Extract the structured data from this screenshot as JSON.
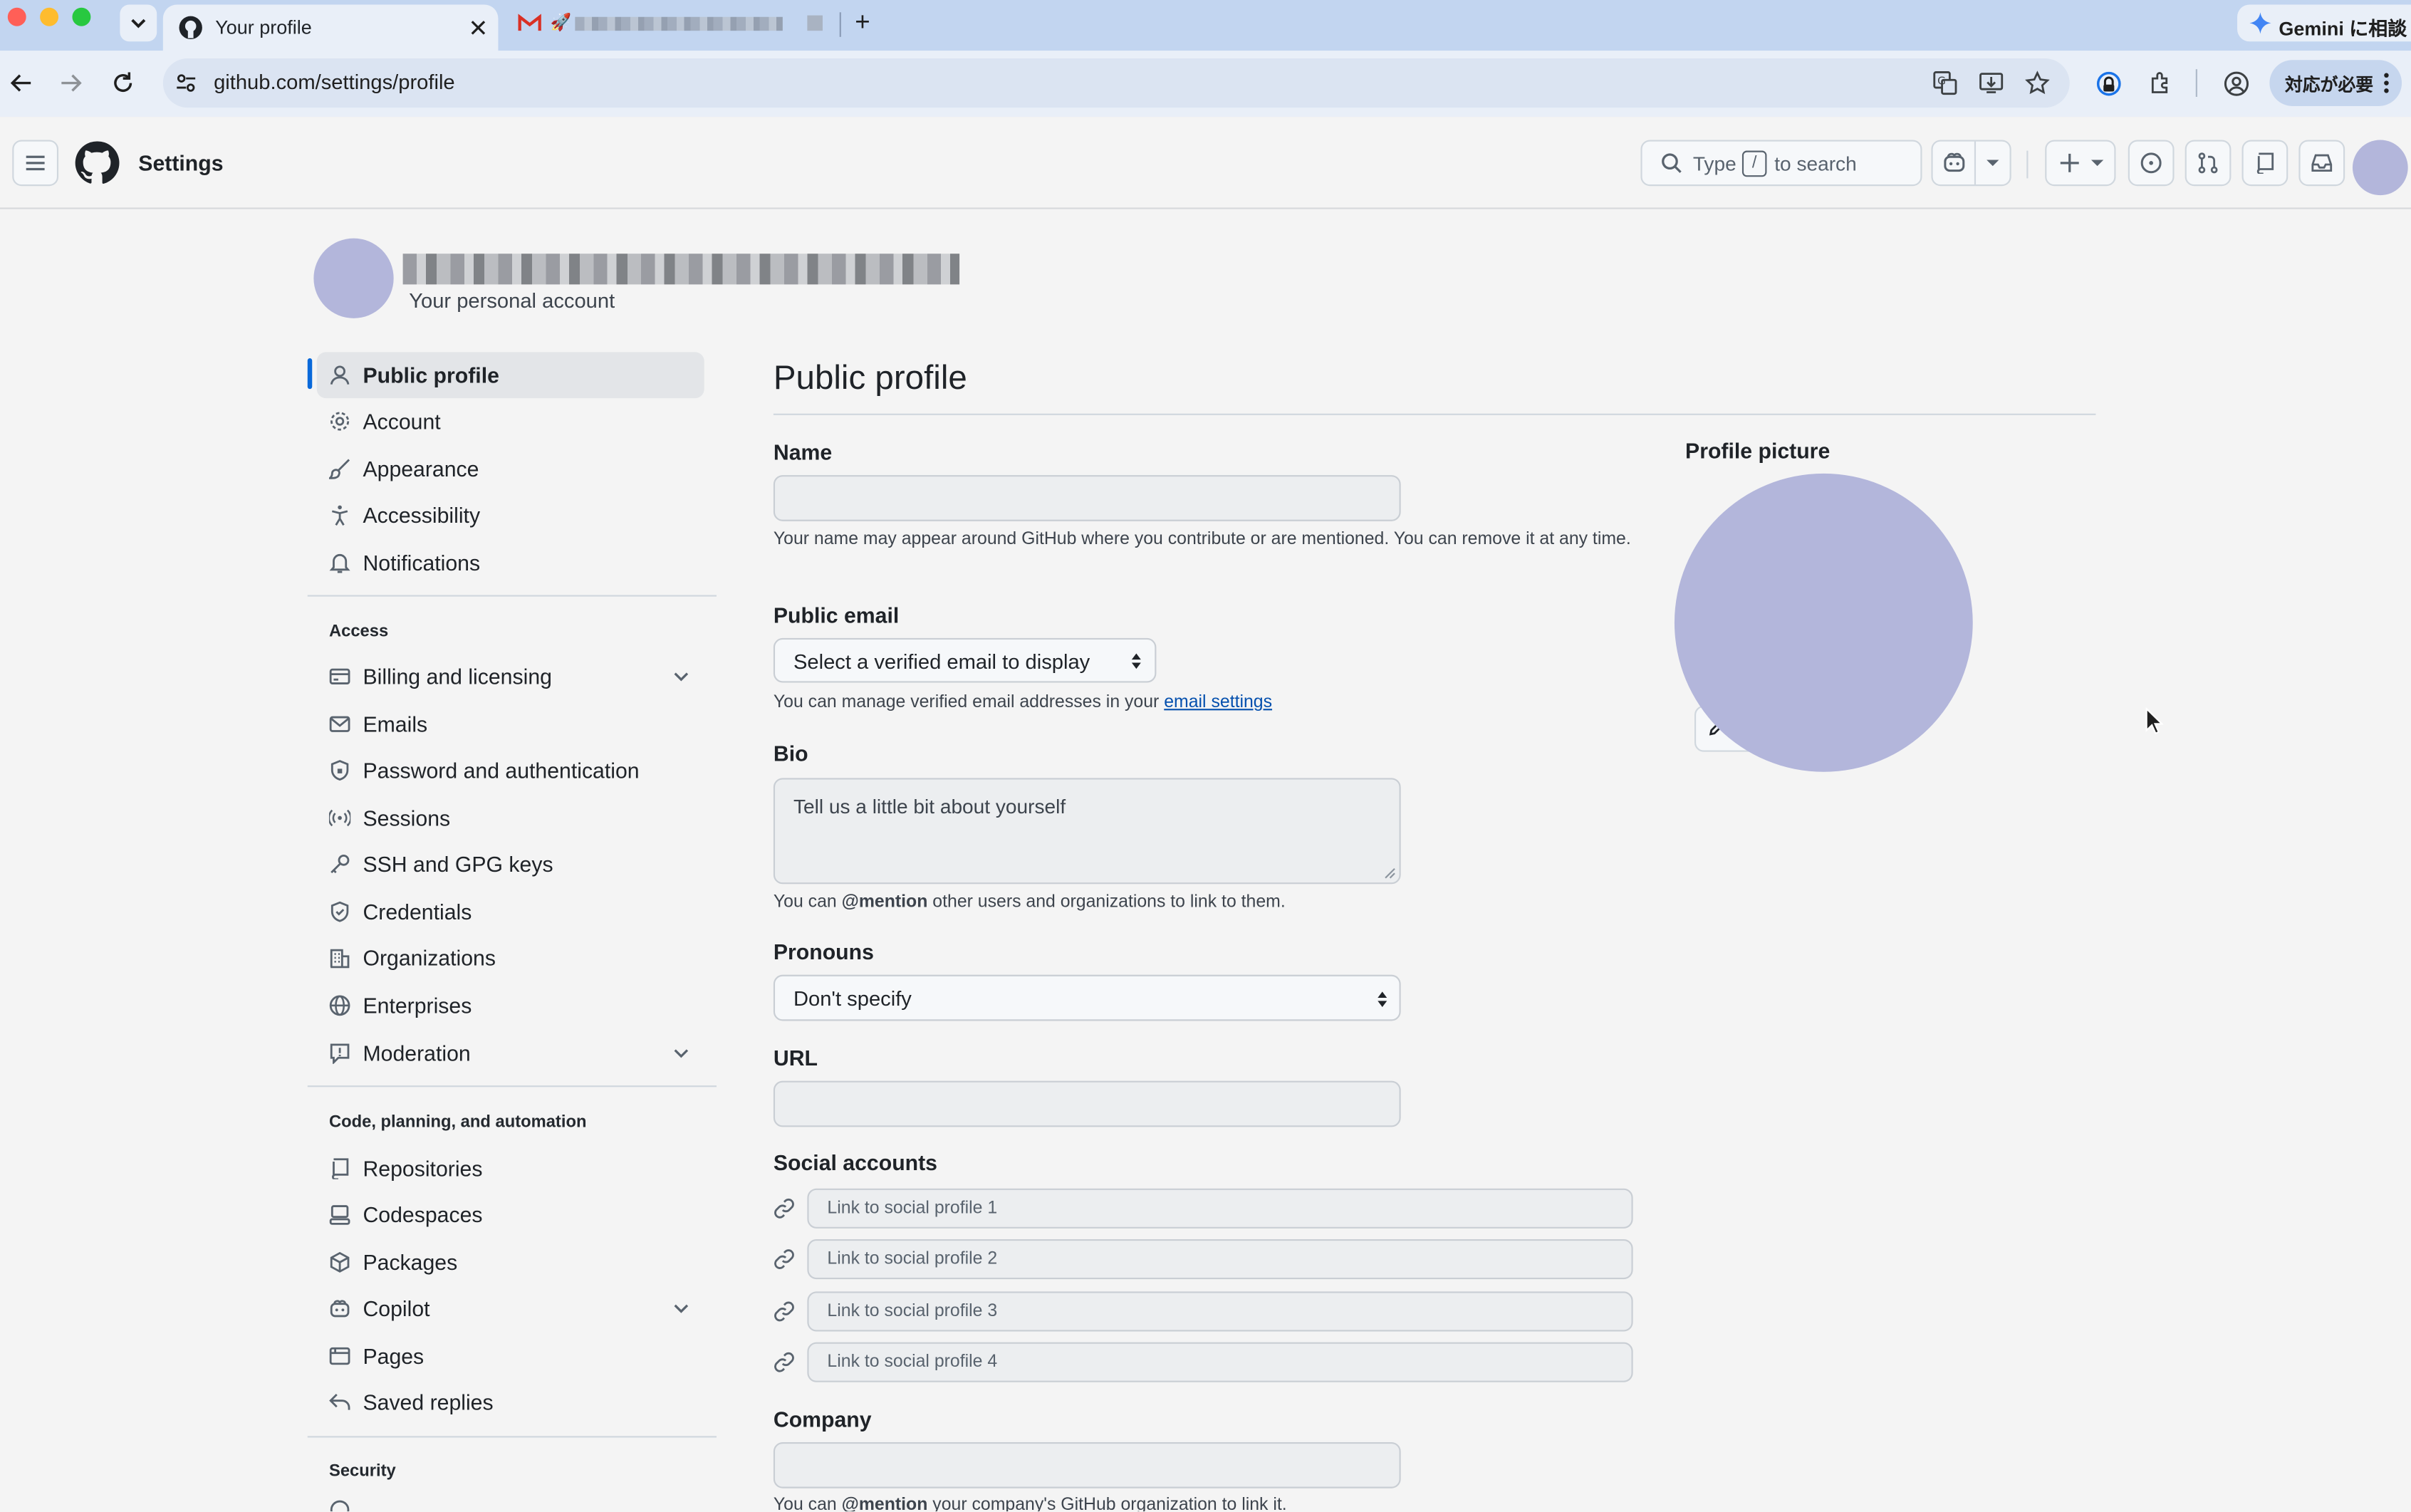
{
  "browser": {
    "active_tab_title": "Your profile",
    "new_tab": "+",
    "url": "github.com/settings/profile",
    "gemini_label": "Gemini に相談",
    "update_label": "対応が必要"
  },
  "header": {
    "title": "Settings",
    "search_prefix": "Type",
    "search_key": "/",
    "search_suffix": "to search"
  },
  "account": {
    "subtitle": "Your personal account"
  },
  "sidebar": {
    "items": [
      {
        "label": "Public profile",
        "icon": "person-icon",
        "active": true
      },
      {
        "label": "Account",
        "icon": "gear-icon"
      },
      {
        "label": "Appearance",
        "icon": "paintbrush-icon"
      },
      {
        "label": "Accessibility",
        "icon": "accessibility-icon"
      },
      {
        "label": "Notifications",
        "icon": "bell-icon"
      }
    ],
    "access_heading": "Access",
    "access_items": [
      {
        "label": "Billing and licensing",
        "icon": "credit-card-icon",
        "expandable": true
      },
      {
        "label": "Emails",
        "icon": "mail-icon"
      },
      {
        "label": "Password and authentication",
        "icon": "shield-lock-icon"
      },
      {
        "label": "Sessions",
        "icon": "broadcast-icon"
      },
      {
        "label": "SSH and GPG keys",
        "icon": "key-icon"
      },
      {
        "label": "Credentials",
        "icon": "shield-check-icon"
      },
      {
        "label": "Organizations",
        "icon": "organization-icon"
      },
      {
        "label": "Enterprises",
        "icon": "globe-icon"
      },
      {
        "label": "Moderation",
        "icon": "report-icon",
        "expandable": true
      }
    ],
    "code_heading": "Code, planning, and automation",
    "code_items": [
      {
        "label": "Repositories",
        "icon": "repo-icon"
      },
      {
        "label": "Codespaces",
        "icon": "codespaces-icon"
      },
      {
        "label": "Packages",
        "icon": "package-icon"
      },
      {
        "label": "Copilot",
        "icon": "copilot-icon",
        "expandable": true
      },
      {
        "label": "Pages",
        "icon": "browser-icon"
      },
      {
        "label": "Saved replies",
        "icon": "reply-icon"
      }
    ],
    "security_heading": "Security"
  },
  "main": {
    "title": "Public profile",
    "name_label": "Name",
    "name_value": "",
    "name_note": "Your name may appear around GitHub where you contribute or are mentioned. You can remove it at any time.",
    "email_label": "Public email",
    "email_select": "Select a verified email to display",
    "email_note_prefix": "You can manage verified email addresses in your",
    "email_note_link": "email settings",
    "bio_label": "Bio",
    "bio_placeholder": "Tell us a little bit about yourself",
    "bio_note_prefix": "You can",
    "bio_note_mention": "@mention",
    "bio_note_suffix": "other users and organizations to link to them.",
    "pronouns_label": "Pronouns",
    "pronouns_value": "Don't specify",
    "url_label": "URL",
    "url_value": "",
    "social_label": "Social accounts",
    "social_placeholders": [
      "Link to social profile 1",
      "Link to social profile 2",
      "Link to social profile 3",
      "Link to social profile 4"
    ],
    "company_label": "Company",
    "company_note_prefix": "You can",
    "company_note_mention": "@mention",
    "company_note_suffix": "your company's GitHub organization to link it."
  },
  "profile_picture": {
    "label": "Profile picture",
    "avatar_color": "#b3b6db"
  },
  "colors": {
    "accent": "#0969da",
    "link": "#0550ae",
    "avatar": "#b3b6db"
  }
}
